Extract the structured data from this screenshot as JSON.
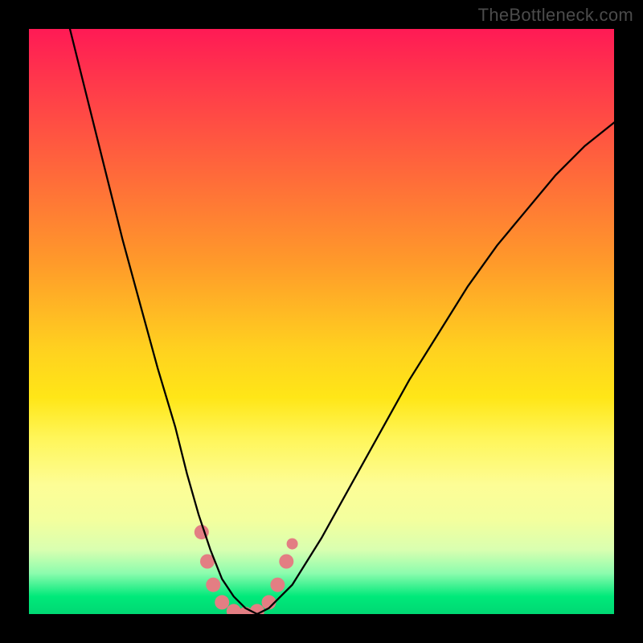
{
  "watermark": "TheBottleneck.com",
  "chart_data": {
    "type": "line",
    "title": "",
    "xlabel": "",
    "ylabel": "",
    "xlim": [
      0,
      100
    ],
    "ylim": [
      0,
      100
    ],
    "grid": false,
    "legend": false,
    "series": [
      {
        "name": "bottleneck-curve",
        "x": [
          7,
          10,
          13,
          16,
          19,
          22,
          25,
          27,
          29,
          31,
          33,
          35,
          37,
          39,
          41,
          45,
          50,
          55,
          60,
          65,
          70,
          75,
          80,
          85,
          90,
          95,
          100
        ],
        "y": [
          100,
          88,
          76,
          64,
          53,
          42,
          32,
          24,
          17,
          11,
          6,
          3,
          1,
          0,
          1,
          5,
          13,
          22,
          31,
          40,
          48,
          56,
          63,
          69,
          75,
          80,
          84
        ]
      }
    ],
    "markers": [
      {
        "x": 29.5,
        "y": 14,
        "r": 9,
        "color": "#e37e83"
      },
      {
        "x": 30.5,
        "y": 9,
        "r": 9,
        "color": "#e37e83"
      },
      {
        "x": 31.5,
        "y": 5,
        "r": 9,
        "color": "#e37e83"
      },
      {
        "x": 33.0,
        "y": 2,
        "r": 9,
        "color": "#e37e83"
      },
      {
        "x": 35.0,
        "y": 0.5,
        "r": 9,
        "color": "#e37e83"
      },
      {
        "x": 37.0,
        "y": 0,
        "r": 9,
        "color": "#e37e83"
      },
      {
        "x": 39.0,
        "y": 0.5,
        "r": 9,
        "color": "#e37e83"
      },
      {
        "x": 41.0,
        "y": 2,
        "r": 9,
        "color": "#e37e83"
      },
      {
        "x": 42.5,
        "y": 5,
        "r": 9,
        "color": "#e37e83"
      },
      {
        "x": 44.0,
        "y": 9,
        "r": 9,
        "color": "#e37e83"
      },
      {
        "x": 45.0,
        "y": 12,
        "r": 7,
        "color": "#e37e83"
      }
    ]
  }
}
